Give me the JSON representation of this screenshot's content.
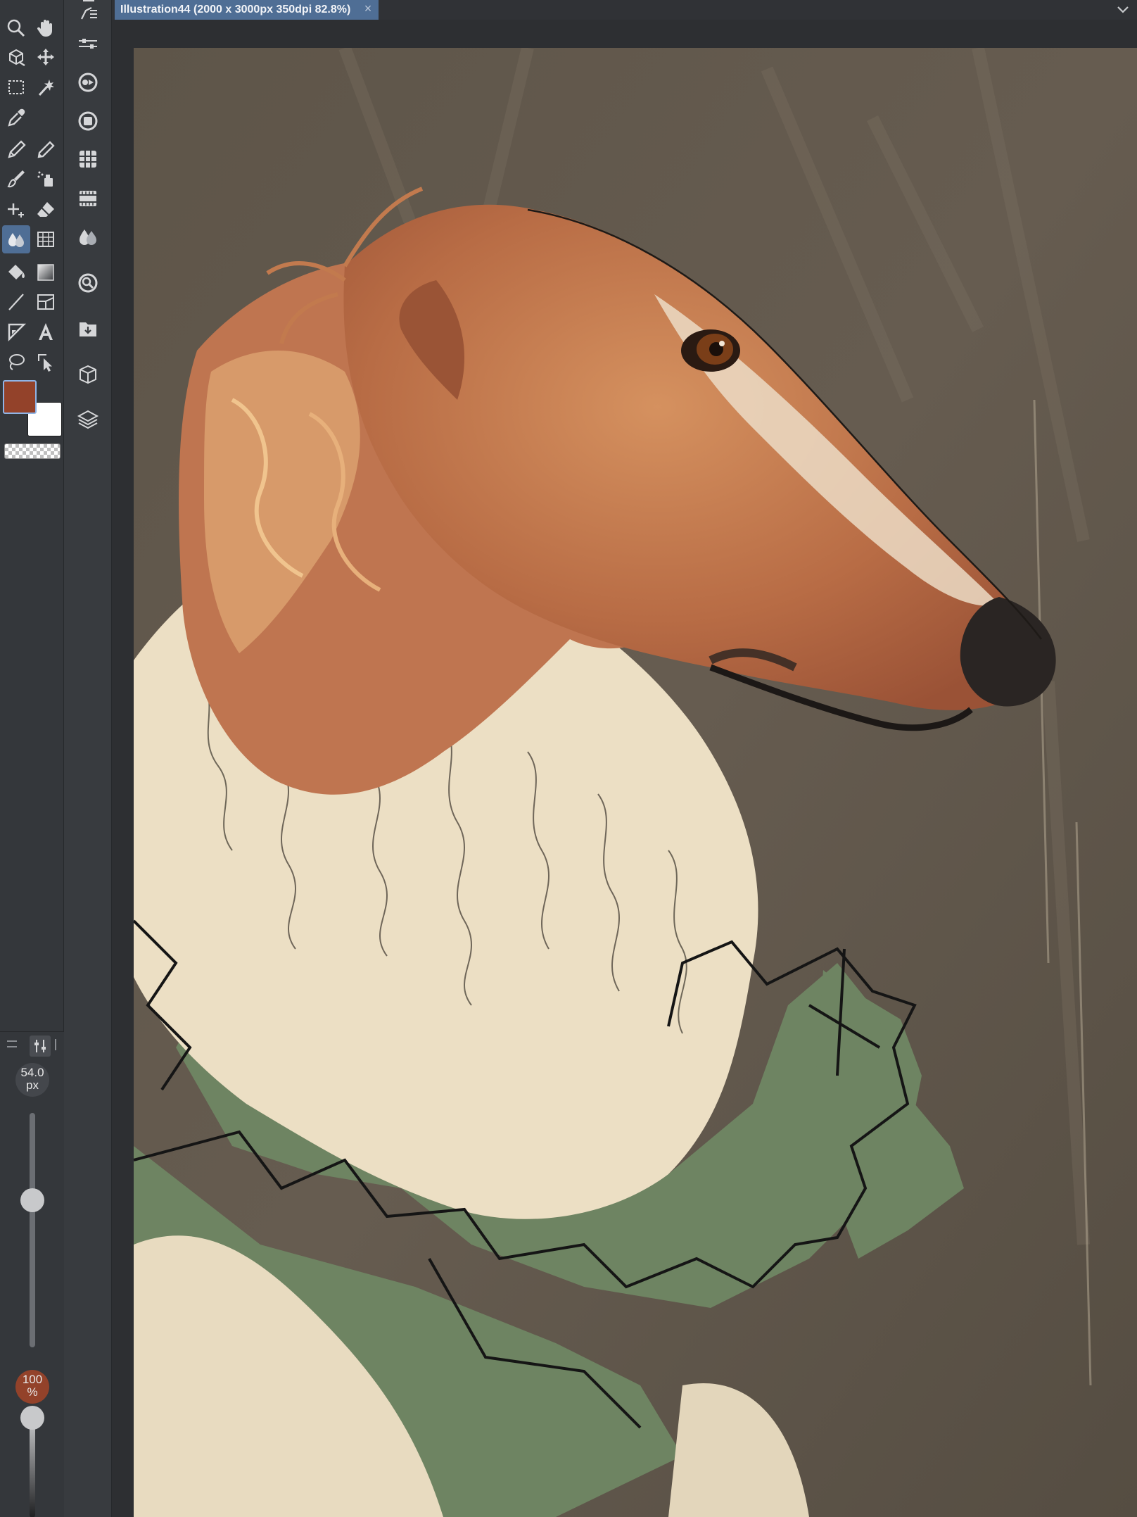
{
  "document_tab": {
    "title": "Illustration44 (2000 x 3000px 350dpi 82.8%)",
    "close_glyph": "×"
  },
  "colors": {
    "main_color": "#93422a",
    "sub_color": "#ffffff",
    "accent_tab": "#4f6e95"
  },
  "tools": [
    "zoom-icon",
    "hand-icon",
    "rotate-3d-icon",
    "move-icon",
    "rect-selection-icon",
    "magic-wand-icon",
    "eyedropper-icon",
    "pen-icon",
    "pencil-icon",
    "brush-icon",
    "airbrush-icon",
    "decoration-icon",
    "eraser-icon",
    "blend-icon",
    "figure-fill-icon",
    "fill-icon",
    "gradient-icon",
    "line-icon",
    "frame-icon",
    "ruler-icon",
    "text-icon",
    "lasso-icon",
    "object-select-icon"
  ],
  "tool_property": {
    "size_value": "54.0",
    "size_unit": "px",
    "opacity_value": "100",
    "opacity_unit": "%",
    "size_level": 0.37,
    "opacity_level": 1.0
  },
  "command_bar": [
    "sub-tool-icon",
    "tool-property-icon",
    "color-wheel-icon",
    "color-set-icon",
    "color-history-icon",
    "layer-property-icon",
    "timeline-icon",
    "layer-color-icon",
    "navigator-icon",
    "material-icon",
    "3d-layer-icon",
    "layers-icon"
  ]
}
